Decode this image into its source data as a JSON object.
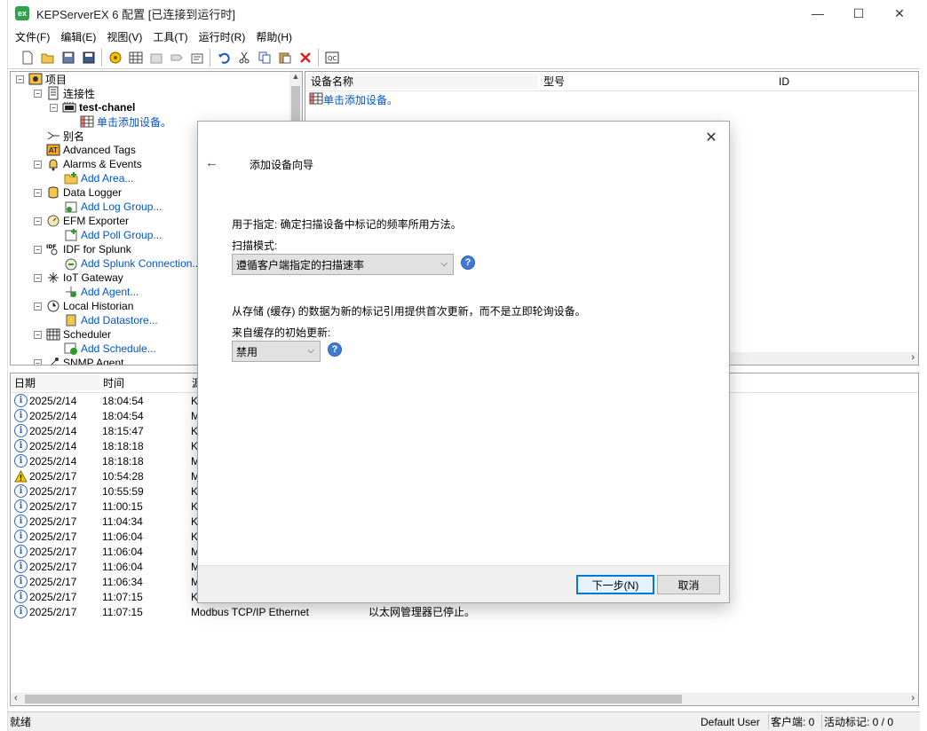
{
  "app": {
    "title": "KEPServerEX 6 配置 [已连接到运行时]",
    "logo_text": "ex",
    "window_controls": {
      "minimize": "—",
      "maximize": "☐",
      "close": "✕"
    }
  },
  "menu": [
    "文件(F)",
    "编辑(E)",
    "视图(V)",
    "工具(T)",
    "运行时(R)",
    "帮助(H)"
  ],
  "toolbar_icons": [
    "new-icon",
    "open-icon",
    "save-icon",
    "save-as-icon",
    "new-channel-icon",
    "new-device-icon",
    "new-group-icon",
    "new-tag-icon",
    "properties-icon",
    "undo-icon",
    "cut-icon",
    "copy-icon",
    "paste-icon",
    "delete-icon",
    "quick-client-icon"
  ],
  "tree": {
    "root": "项目",
    "connectivity": "连接性",
    "channel": "test-chanel",
    "add_device": "单击添加设备。",
    "alias": "别名",
    "advanced_tags": "Advanced Tags",
    "alarms": "Alarms & Events",
    "add_area": "Add Area...",
    "data_logger": "Data Logger",
    "add_log_group": "Add Log Group...",
    "efm": "EFM Exporter",
    "add_poll_group": "Add Poll Group...",
    "idf": "IDF for Splunk",
    "add_splunk": "Add Splunk Connection...",
    "iot": "IoT Gateway",
    "add_agent": "Add Agent...",
    "historian": "Local Historian",
    "add_datastore": "Add Datastore...",
    "scheduler": "Scheduler",
    "add_schedule": "Add Schedule...",
    "snmp": "SNMP Agent"
  },
  "device_pane": {
    "col_name": "设备名称",
    "col_model": "型号",
    "col_id": "ID",
    "add_device": "单击添加设备。"
  },
  "log": {
    "col_date": "日期",
    "col_time": "时间",
    "col_source": "源",
    "rows": [
      {
        "icon": "info",
        "date": "2025/2/14",
        "time": "18:04:54",
        "source": "K",
        "event": ""
      },
      {
        "icon": "info",
        "date": "2025/2/14",
        "time": "18:04:54",
        "source": "M",
        "event": ""
      },
      {
        "icon": "info",
        "date": "2025/2/14",
        "time": "18:15:47",
        "source": "K",
        "event": ""
      },
      {
        "icon": "info",
        "date": "2025/2/14",
        "time": "18:18:18",
        "source": "K",
        "event": ""
      },
      {
        "icon": "info",
        "date": "2025/2/14",
        "time": "18:18:18",
        "source": "M",
        "event": ""
      },
      {
        "icon": "warn",
        "date": "2025/2/17",
        "time": "10:54:28",
        "source": "M",
        "event": ""
      },
      {
        "icon": "info",
        "date": "2025/2/17",
        "time": "10:55:59",
        "source": "K",
        "event": ""
      },
      {
        "icon": "info",
        "date": "2025/2/17",
        "time": "11:00:15",
        "source": "K",
        "event": ""
      },
      {
        "icon": "info",
        "date": "2025/2/17",
        "time": "11:04:34",
        "source": "K",
        "event": ""
      },
      {
        "icon": "info",
        "date": "2025/2/17",
        "time": "11:06:04",
        "source": "K",
        "event": ""
      },
      {
        "icon": "info",
        "date": "2025/2/17",
        "time": "11:06:04",
        "source": "M",
        "event": ""
      },
      {
        "icon": "info",
        "date": "2025/2/17",
        "time": "11:06:04",
        "source": "M",
        "event": ""
      },
      {
        "icon": "info",
        "date": "2025/2/17",
        "time": "11:06:34",
        "source": "M",
        "event": ""
      },
      {
        "icon": "info",
        "date": "2025/2/17",
        "time": "11:07:15",
        "source": "K",
        "event": ""
      },
      {
        "icon": "info",
        "date": "2025/2/17",
        "time": "11:07:15",
        "source": "Modbus TCP/IP Ethernet",
        "event": "以太网管理器已停止。"
      }
    ]
  },
  "status": {
    "left": "就绪",
    "user": "Default User",
    "clients": "客户端: 0",
    "active_tags": "活动标记: 0 / 0"
  },
  "dialog": {
    "title": "添加设备向导",
    "desc1": "用于指定: 确定扫描设备中标记的频率所用方法。",
    "scan_mode_label": "扫描模式:",
    "scan_mode_value": "遵循客户端指定的扫描速率",
    "desc2": "从存储 (缓存) 的数据为新的标记引用提供首次更新，而不是立即轮询设备。",
    "initial_update_label": "来自缓存的初始更新:",
    "initial_update_value": "禁用",
    "help": "?",
    "next_button": "下一步(N)",
    "cancel_button": "取消",
    "close": "✕",
    "back": "←"
  }
}
